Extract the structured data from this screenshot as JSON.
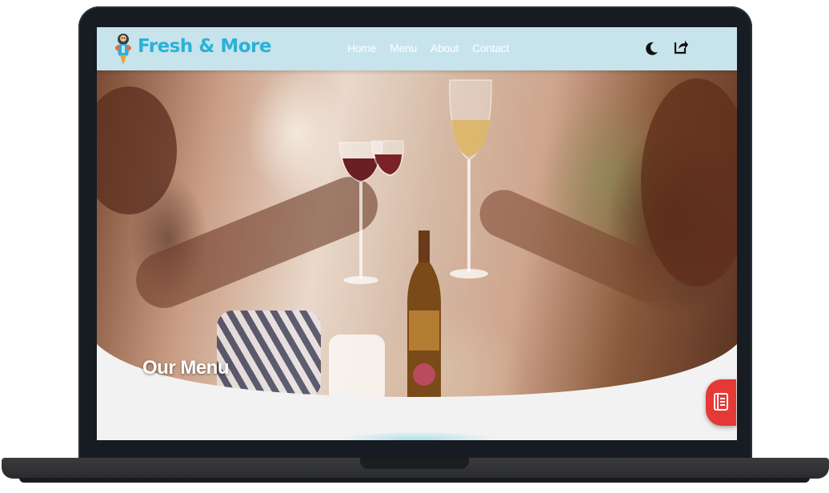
{
  "brand": {
    "name": "Fresh & More",
    "logo_icon": "mascot-icon",
    "color": "#2bb1d6"
  },
  "nav": {
    "items": [
      {
        "label": "Home"
      },
      {
        "label": "Menu"
      },
      {
        "label": "About"
      },
      {
        "label": "Contact"
      }
    ],
    "theme_toggle_icon": "moon-icon",
    "share_icon": "share-icon",
    "background": "#c7e3ec"
  },
  "hero": {
    "title": "Our Menu",
    "image": "friends-toasting-wine"
  },
  "floating_button": {
    "icon": "menu-book-icon",
    "color": "#e53935"
  }
}
